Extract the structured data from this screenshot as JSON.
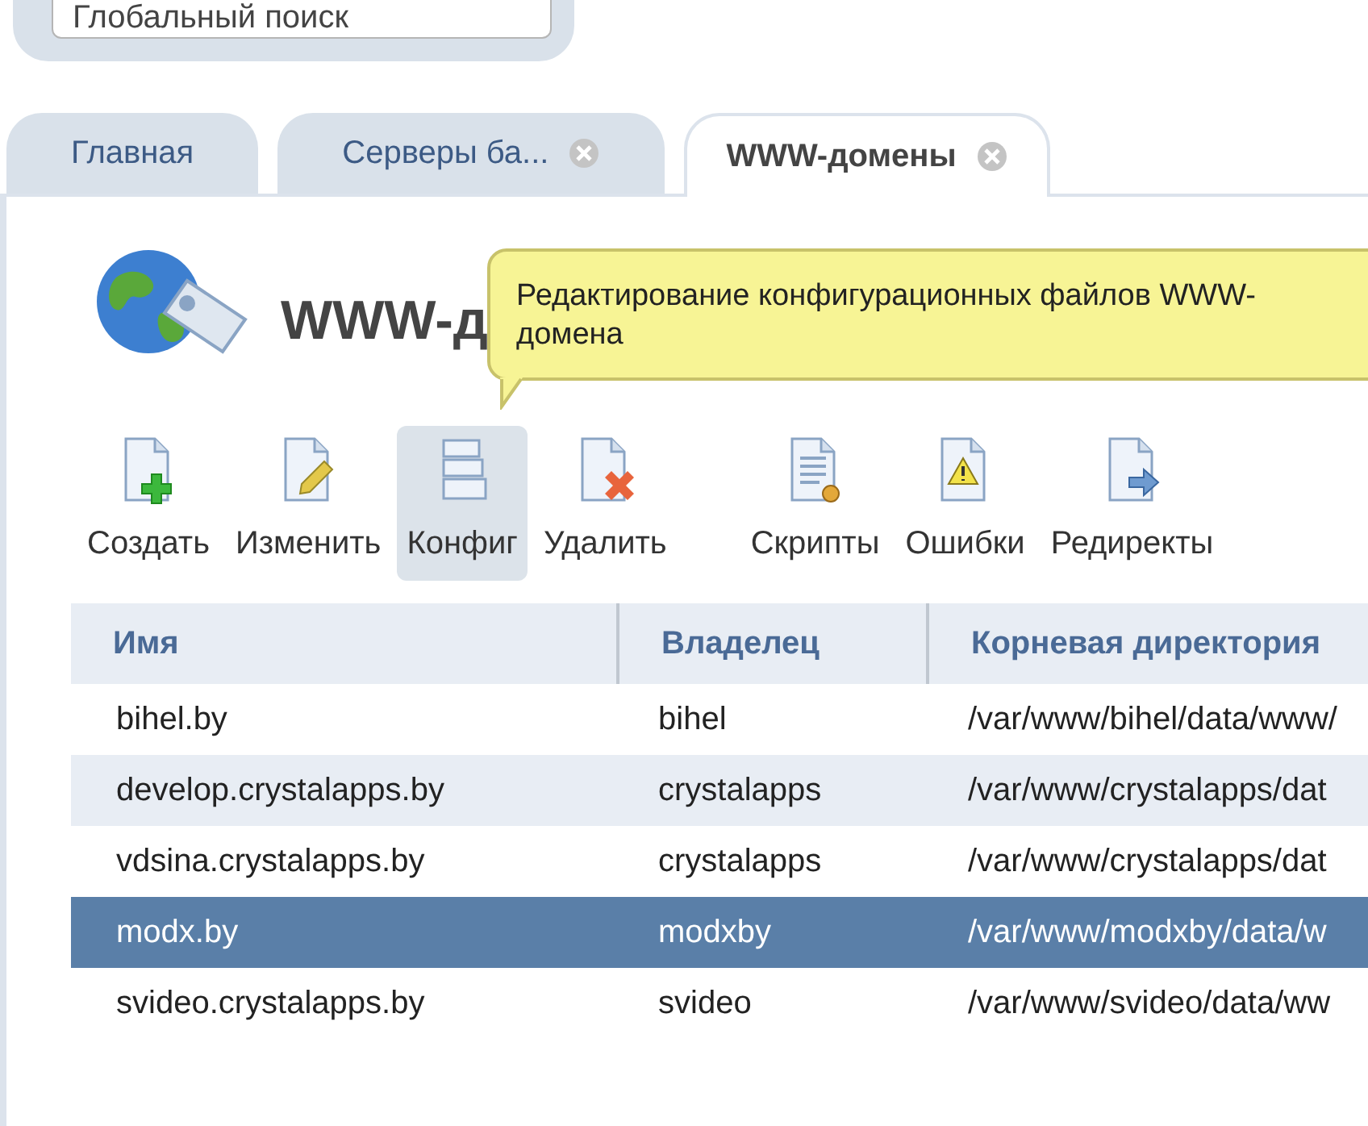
{
  "search": {
    "placeholder": "Глобальный поиск"
  },
  "tabs": [
    {
      "label": "Главная",
      "selected": false,
      "closable": false
    },
    {
      "label": "Серверы ба...",
      "selected": false,
      "closable": true
    },
    {
      "label": "WWW-домены",
      "selected": true,
      "closable": true
    }
  ],
  "page_title": "WWW-д",
  "tooltip": {
    "lines": [
      "Редактирование конфигурационных файлов WWW-",
      "домена"
    ]
  },
  "toolbar": [
    {
      "label": "Создать",
      "kind": "create",
      "highlighted": false
    },
    {
      "label": "Изменить",
      "kind": "edit",
      "highlighted": false
    },
    {
      "label": "Конфиг",
      "kind": "config",
      "highlighted": true
    },
    {
      "label": "Удалить",
      "kind": "delete",
      "highlighted": false
    },
    {
      "label": "Скрипты",
      "kind": "scripts",
      "highlighted": false
    },
    {
      "label": "Ошибки",
      "kind": "errors",
      "highlighted": false
    },
    {
      "label": "Редиректы",
      "kind": "redirects",
      "highlighted": false
    }
  ],
  "table": {
    "columns": [
      "Имя",
      "Владелец",
      "Корневая директория"
    ],
    "rows": [
      {
        "cells": [
          "bihel.by",
          "bihel",
          "/var/www/bihel/data/www/"
        ],
        "selected": false
      },
      {
        "cells": [
          "develop.crystalapps.by",
          "crystalapps",
          "/var/www/crystalapps/dat"
        ],
        "selected": false
      },
      {
        "cells": [
          "vdsina.crystalapps.by",
          "crystalapps",
          "/var/www/crystalapps/dat"
        ],
        "selected": false
      },
      {
        "cells": [
          "modx.by",
          "modxby",
          "/var/www/modxby/data/w"
        ],
        "selected": true
      },
      {
        "cells": [
          "svideo.crystalapps.by",
          "svideo",
          "/var/www/svideo/data/ww"
        ],
        "selected": false
      }
    ]
  }
}
